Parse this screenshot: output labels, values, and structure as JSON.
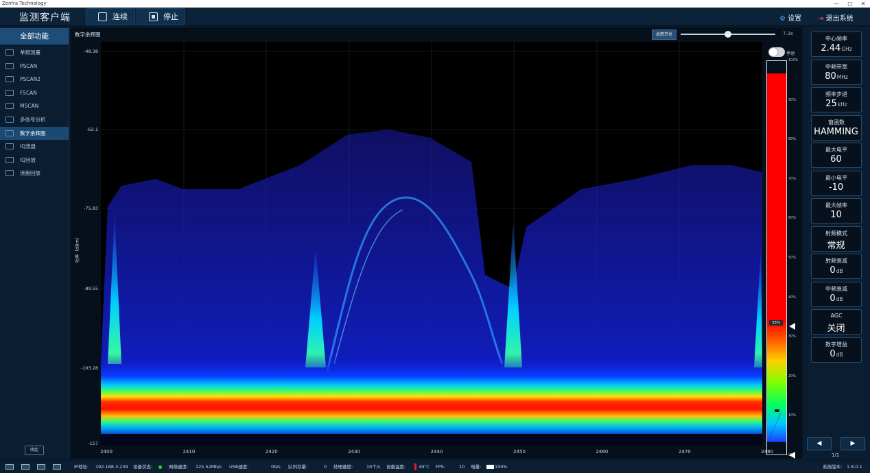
{
  "window": {
    "title": "Zenfra Technology",
    "controls": [
      "—",
      "□",
      "✕"
    ]
  },
  "header": {
    "app_title": "监测客户端",
    "continuous_label": "连续",
    "stop_label": "停止",
    "settings_label": "设置",
    "exit_label": "退出系统"
  },
  "sidebar": {
    "header": "全部功能",
    "items": [
      {
        "label": "单频测量",
        "active": false
      },
      {
        "label": "PSCAN",
        "active": false
      },
      {
        "label": "PSCAN2",
        "active": false
      },
      {
        "label": "FSCAN",
        "active": false
      },
      {
        "label": "MSCAN",
        "active": false
      },
      {
        "label": "多信号分析",
        "active": false
      },
      {
        "label": "数字余辉图",
        "active": true
      },
      {
        "label": "IQ流盘",
        "active": false
      },
      {
        "label": "IQ回放",
        "active": false
      },
      {
        "label": "流盘回放",
        "active": false
      }
    ],
    "collapse_label": "收起"
  },
  "main": {
    "panel_title": "数字余辉图",
    "refresh_label": "余辉开关",
    "speed_value": "7.3s",
    "speed_fraction": 0.5,
    "toggle_label": "手动",
    "y_axis_label": "功率（dBm）",
    "y_ticks": [
      "-48.38",
      "-62.1",
      "-75.83",
      "-89.55",
      "-103.28",
      "-117"
    ],
    "x_ticks": [
      "2400",
      "2410",
      "2420",
      "2430",
      "2440",
      "2450",
      "2460",
      "2470",
      "2480"
    ],
    "colorbar_ticks": [
      "100%",
      "90%",
      "80%",
      "70%",
      "60%",
      "50%",
      "40%",
      "30%",
      "20%",
      "10%",
      "0%"
    ],
    "colorbar_level": "33%",
    "colorbar_level_value": 0.33
  },
  "params": [
    {
      "label": "中心频率",
      "value": "2.44",
      "unit": "GHz"
    },
    {
      "label": "中频带宽",
      "value": "80",
      "unit": "MHz"
    },
    {
      "label": "频率步进",
      "value": "25",
      "unit": "kHz"
    },
    {
      "label": "窗函数",
      "value": "HAMMING",
      "unit": ""
    },
    {
      "label": "最大电平",
      "value": "60",
      "unit": ""
    },
    {
      "label": "最小电平",
      "value": "-10",
      "unit": ""
    },
    {
      "label": "最大帧率",
      "value": "10",
      "unit": ""
    },
    {
      "label": "射频模式",
      "value": "常规",
      "unit": ""
    },
    {
      "label": "射频衰减",
      "value": "0",
      "unit": "dB"
    },
    {
      "label": "中频衰减",
      "value": "0",
      "unit": "dB"
    },
    {
      "label": "AGC",
      "value": "关闭",
      "unit": ""
    },
    {
      "label": "数字增益",
      "value": "0",
      "unit": "dB"
    }
  ],
  "pager": {
    "prev": "◀",
    "next": "▶",
    "label": "1/1"
  },
  "status": {
    "ip_label": "IP地址:",
    "ip": "192.168.3.239",
    "dev_state_label": "设备状态:",
    "net_speed_label": "网络速度:",
    "net_speed": "125.52Mb/s",
    "usb_speed_label": "USB速度:",
    "usb_speed": "0b/s",
    "queue_label": "队列存量:",
    "queue": "0",
    "proc_speed_label": "处理速度:",
    "proc_speed": "10个/s",
    "temp_label": "设备温度:",
    "temp": "49°C",
    "fps_label": "FPS:",
    "fps": "10",
    "battery_label": "电量:",
    "battery": "100%",
    "version_label": "系统版本:",
    "version": "1.8.0.1"
  }
}
